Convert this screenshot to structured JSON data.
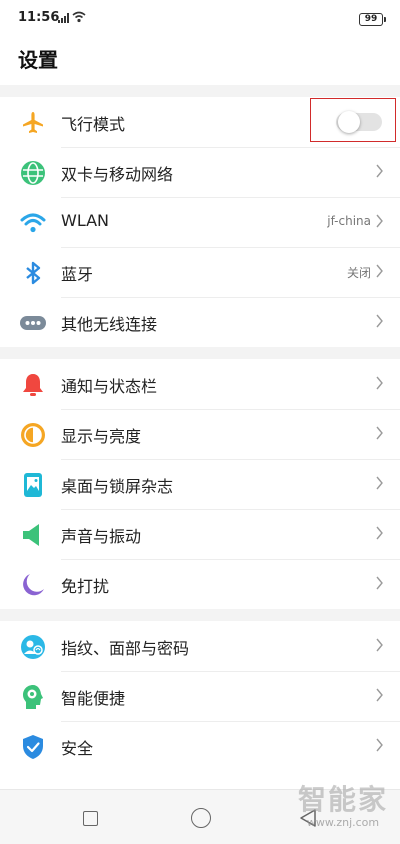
{
  "status": {
    "time": "11:56",
    "battery": "99"
  },
  "page": {
    "title": "设置"
  },
  "groups": [
    {
      "items": [
        {
          "label": "飞行模式",
          "icon": "airplane-icon",
          "control": "toggle",
          "state": "off"
        },
        {
          "label": "双卡与移动网络",
          "icon": "globe-icon"
        },
        {
          "label": "WLAN",
          "icon": "wifi-icon",
          "value": "jf-china"
        },
        {
          "label": "蓝牙",
          "icon": "bluetooth-icon",
          "value": "关闭"
        },
        {
          "label": "其他无线连接",
          "icon": "more-dots-icon"
        }
      ]
    },
    {
      "items": [
        {
          "label": "通知与状态栏",
          "icon": "bell-icon"
        },
        {
          "label": "显示与亮度",
          "icon": "brightness-icon"
        },
        {
          "label": "桌面与锁屏杂志",
          "icon": "wallpaper-icon"
        },
        {
          "label": "声音与振动",
          "icon": "speaker-icon"
        },
        {
          "label": "免打扰",
          "icon": "moon-icon"
        }
      ]
    },
    {
      "items": [
        {
          "label": "指纹、面部与密码",
          "icon": "fingerprint-face-icon"
        },
        {
          "label": "智能便捷",
          "icon": "smart-head-icon"
        },
        {
          "label": "安全",
          "icon": "shield-icon"
        }
      ]
    }
  ],
  "watermark": {
    "main": "智能家",
    "sub": "www.znj.com"
  },
  "colors": {
    "airplane": "#f5a623",
    "globe": "#3cc27a",
    "wifi": "#2ba6e8",
    "bluetooth": "#2b8be0",
    "more": "#7b8a99",
    "bell": "#f0473f",
    "brightness": "#f5a623",
    "wallpaper": "#1fb8d6",
    "speaker": "#3cc27a",
    "moon": "#8a63d2",
    "fingerprint": "#2bb8e6",
    "smart": "#3cc27a",
    "shield": "#2b8be0",
    "highlight": "#d12b2b"
  }
}
